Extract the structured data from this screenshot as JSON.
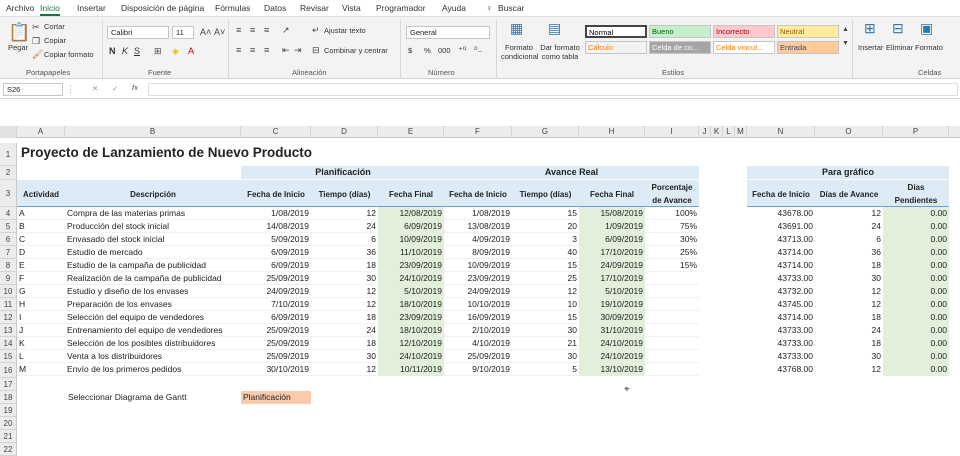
{
  "tabs": [
    "Archivo",
    "Inicio",
    "Insertar",
    "Disposición de página",
    "Fórmulas",
    "Datos",
    "Revisar",
    "Vista",
    "Programador",
    "Ayuda"
  ],
  "search_label": "Buscar",
  "ribbon": {
    "clipboard": {
      "paste": "Pegar",
      "cut": "Cortar",
      "copy": "Copiar",
      "format_painter": "Copiar formato",
      "group": "Portapapeles"
    },
    "font": {
      "name": "Calibri",
      "size": "11",
      "group": "Fuente",
      "bold": "N",
      "italic": "K",
      "underline": "S"
    },
    "alignment": {
      "wrap": "Ajustar texto",
      "merge": "Combinar y centrar",
      "group": "Alineación"
    },
    "number": {
      "format": "General",
      "group": "Número",
      "currency": "$",
      "percent": "%",
      "thousands": "000"
    },
    "styles": {
      "conditional": "Formato condicional",
      "table": "Dar formato como tabla",
      "group": "Estilos",
      "cells": [
        {
          "label": "Normal",
          "bg": "#ffffff",
          "fg": "#000000"
        },
        {
          "label": "Bueno",
          "bg": "#c6efce",
          "fg": "#006100"
        },
        {
          "label": "Incorrecto",
          "bg": "#ffc7ce",
          "fg": "#9c0006"
        },
        {
          "label": "Neutral",
          "bg": "#ffeb9c",
          "fg": "#9c5700"
        },
        {
          "label": "Cálculo",
          "bg": "#f2f2f2",
          "fg": "#fa7d00"
        },
        {
          "label": "Celda de co...",
          "bg": "#a5a5a5",
          "fg": "#ffffff"
        },
        {
          "label": "Celda vincul...",
          "bg": "#ffffff",
          "fg": "#fa7d00"
        },
        {
          "label": "Entrada",
          "bg": "#ffcc99",
          "fg": "#3f3f76"
        }
      ]
    },
    "cells": {
      "insert": "Insertar",
      "delete": "Eliminar",
      "format": "Formato",
      "group": "Celdas"
    }
  },
  "formula_bar": {
    "name_box": "S26",
    "cancel": "✕",
    "enter": "✓",
    "fx": "fx",
    "content": ""
  },
  "columns": [
    "A",
    "B",
    "C",
    "D",
    "E",
    "F",
    "G",
    "H",
    "I",
    "J",
    "K",
    "L",
    "M",
    "N",
    "O",
    "P"
  ],
  "rows": [
    "1",
    "2",
    "3",
    "4",
    "5",
    "6",
    "7",
    "8",
    "9",
    "10",
    "11",
    "12",
    "13",
    "14",
    "15",
    "16",
    "17",
    "18",
    "19",
    "20",
    "21",
    "22"
  ],
  "sheet": {
    "title": "Proyecto de Lanzamiento de Nuevo Producto",
    "planificacion": "Planificación",
    "avance_real": "Avance Real",
    "para_grafico": "Para gráfico",
    "headers": {
      "actividad": "Actividad",
      "descripcion": "Descripción",
      "fecha_inicio": "Fecha de Inicio",
      "tiempo": "Tiempo (días)",
      "fecha_final": "Fecha Final",
      "fecha_inicio2": "Fecha de Inicio",
      "tiempo2": "Tiempo (días)",
      "fecha_final2": "Fecha Final",
      "porcentaje1": "Porcentaje",
      "porcentaje2": "de Avance",
      "fecha_inicio3": "Fecha de Inicio",
      "dias_avance": "Días de Avance",
      "dias_pend1": "Días",
      "dias_pend2": "Pendientes"
    },
    "data": [
      [
        "A",
        "Compra de las materias primas",
        "1/08/2019",
        "12",
        "12/08/2019",
        "1/08/2019",
        "15",
        "15/08/2019",
        "100%",
        "43678.00",
        "12",
        "0.00"
      ],
      [
        "B",
        "Producción del stock inicial",
        "14/08/2019",
        "24",
        "6/09/2019",
        "13/08/2019",
        "20",
        "1/09/2019",
        "75%",
        "43691.00",
        "24",
        "0.00"
      ],
      [
        "C",
        "Envasado del stock inicial",
        "5/09/2019",
        "6",
        "10/09/2019",
        "4/09/2019",
        "3",
        "6/09/2019",
        "30%",
        "43713.00",
        "6",
        "0.00"
      ],
      [
        "D",
        "Estudio de mercado",
        "6/09/2019",
        "36",
        "11/10/2019",
        "8/09/2019",
        "40",
        "17/10/2019",
        "25%",
        "43714.00",
        "36",
        "0.00"
      ],
      [
        "E",
        "Estudio de la campaña de publicidad",
        "6/09/2019",
        "18",
        "23/09/2019",
        "10/09/2019",
        "15",
        "24/09/2019",
        "15%",
        "43714.00",
        "18",
        "0.00"
      ],
      [
        "F",
        "Realización de la campaña de publicidad",
        "25/09/2019",
        "30",
        "24/10/2019",
        "23/09/2019",
        "25",
        "17/10/2019",
        "",
        "43733.00",
        "30",
        "0.00"
      ],
      [
        "G",
        "Estudio y diseño de los envases",
        "24/09/2019",
        "12",
        "5/10/2019",
        "24/09/2019",
        "12",
        "5/10/2019",
        "",
        "43732.00",
        "12",
        "0.00"
      ],
      [
        "H",
        "Preparación de los envases",
        "7/10/2019",
        "12",
        "18/10/2019",
        "10/10/2019",
        "10",
        "19/10/2019",
        "",
        "43745.00",
        "12",
        "0.00"
      ],
      [
        "I",
        "Selección del equipo de vendedores",
        "6/09/2019",
        "18",
        "23/09/2019",
        "16/09/2019",
        "15",
        "30/09/2019",
        "",
        "43714.00",
        "18",
        "0.00"
      ],
      [
        "J",
        "Entrenamiento del equipo de vendedores",
        "25/09/2019",
        "24",
        "18/10/2019",
        "2/10/2019",
        "30",
        "31/10/2019",
        "",
        "43733.00",
        "24",
        "0.00"
      ],
      [
        "K",
        "Selección de los posibles distribuidores",
        "25/09/2019",
        "18",
        "12/10/2019",
        "4/10/2019",
        "21",
        "24/10/2019",
        "",
        "43733.00",
        "18",
        "0.00"
      ],
      [
        "L",
        "Venta a los distribuidores",
        "25/09/2019",
        "30",
        "24/10/2019",
        "25/09/2019",
        "30",
        "24/10/2019",
        "",
        "43733.00",
        "30",
        "0.00"
      ],
      [
        "M",
        "Envío de los primeros pedidos",
        "30/10/2019",
        "12",
        "10/11/2019",
        "9/10/2019",
        "5",
        "13/10/2019",
        "",
        "43768.00",
        "12",
        "0.00"
      ]
    ],
    "select_label": "Seleccionar Diagrama de Gantt",
    "select_value": "Planificación"
  }
}
